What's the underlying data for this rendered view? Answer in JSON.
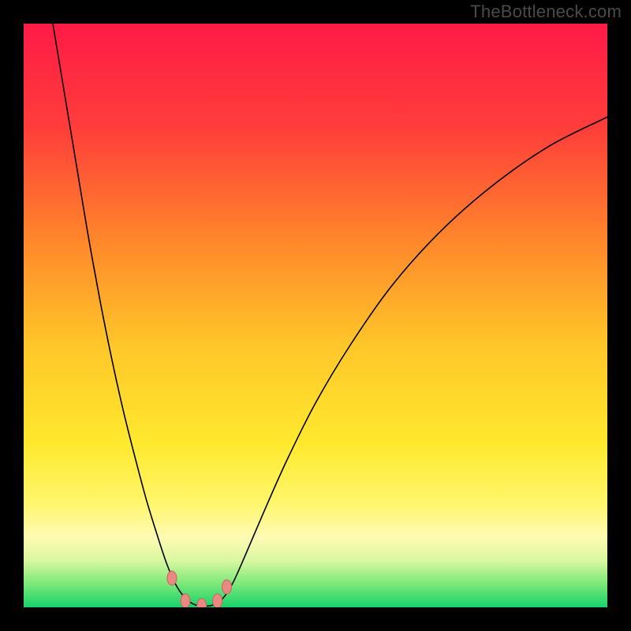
{
  "watermark": "TheBottleneck.com",
  "chart_data": {
    "type": "line",
    "title": "",
    "xlabel": "",
    "ylabel": "",
    "xlim": [
      0,
      100
    ],
    "ylim": [
      0,
      100
    ],
    "background_gradient": {
      "stops": [
        {
          "offset": 0.0,
          "color": "#ff1a47"
        },
        {
          "offset": 0.18,
          "color": "#ff3e3a"
        },
        {
          "offset": 0.38,
          "color": "#ff8a2a"
        },
        {
          "offset": 0.55,
          "color": "#ffc629"
        },
        {
          "offset": 0.72,
          "color": "#ffe92e"
        },
        {
          "offset": 0.82,
          "color": "#fff66a"
        },
        {
          "offset": 0.88,
          "color": "#fffbb4"
        },
        {
          "offset": 0.92,
          "color": "#d8f8a0"
        },
        {
          "offset": 0.96,
          "color": "#7be879"
        },
        {
          "offset": 1.0,
          "color": "#16d36a"
        }
      ]
    },
    "series": [
      {
        "name": "bottleneck-curve",
        "color": "#000000",
        "width": 1.6,
        "points": [
          {
            "x": 5.0,
            "y": 100.0
          },
          {
            "x": 7.0,
            "y": 88.0
          },
          {
            "x": 9.0,
            "y": 76.0
          },
          {
            "x": 11.0,
            "y": 64.0
          },
          {
            "x": 13.0,
            "y": 53.0
          },
          {
            "x": 15.0,
            "y": 43.0
          },
          {
            "x": 17.0,
            "y": 34.0
          },
          {
            "x": 19.0,
            "y": 26.0
          },
          {
            "x": 21.0,
            "y": 18.5
          },
          {
            "x": 23.0,
            "y": 12.0
          },
          {
            "x": 24.5,
            "y": 7.5
          },
          {
            "x": 26.0,
            "y": 4.0
          },
          {
            "x": 27.5,
            "y": 1.8
          },
          {
            "x": 29.0,
            "y": 0.6
          },
          {
            "x": 31.0,
            "y": 0.2
          },
          {
            "x": 33.0,
            "y": 0.6
          },
          {
            "x": 34.5,
            "y": 2.0
          },
          {
            "x": 36.0,
            "y": 4.5
          },
          {
            "x": 38.0,
            "y": 9.0
          },
          {
            "x": 41.0,
            "y": 16.0
          },
          {
            "x": 45.0,
            "y": 25.0
          },
          {
            "x": 50.0,
            "y": 35.0
          },
          {
            "x": 56.0,
            "y": 45.0
          },
          {
            "x": 63.0,
            "y": 55.0
          },
          {
            "x": 71.0,
            "y": 64.0
          },
          {
            "x": 80.0,
            "y": 72.0
          },
          {
            "x": 90.0,
            "y": 79.0
          },
          {
            "x": 100.0,
            "y": 84.0
          }
        ]
      }
    ],
    "markers": [
      {
        "x": 25.4,
        "y": 5.0
      },
      {
        "x": 27.7,
        "y": 1.1
      },
      {
        "x": 30.5,
        "y": 0.3
      },
      {
        "x": 33.2,
        "y": 1.1
      },
      {
        "x": 34.8,
        "y": 3.5
      }
    ],
    "marker_style": {
      "fill": "#e98a82",
      "stroke": "#c9655c",
      "rx": 6,
      "ry": 9
    }
  }
}
